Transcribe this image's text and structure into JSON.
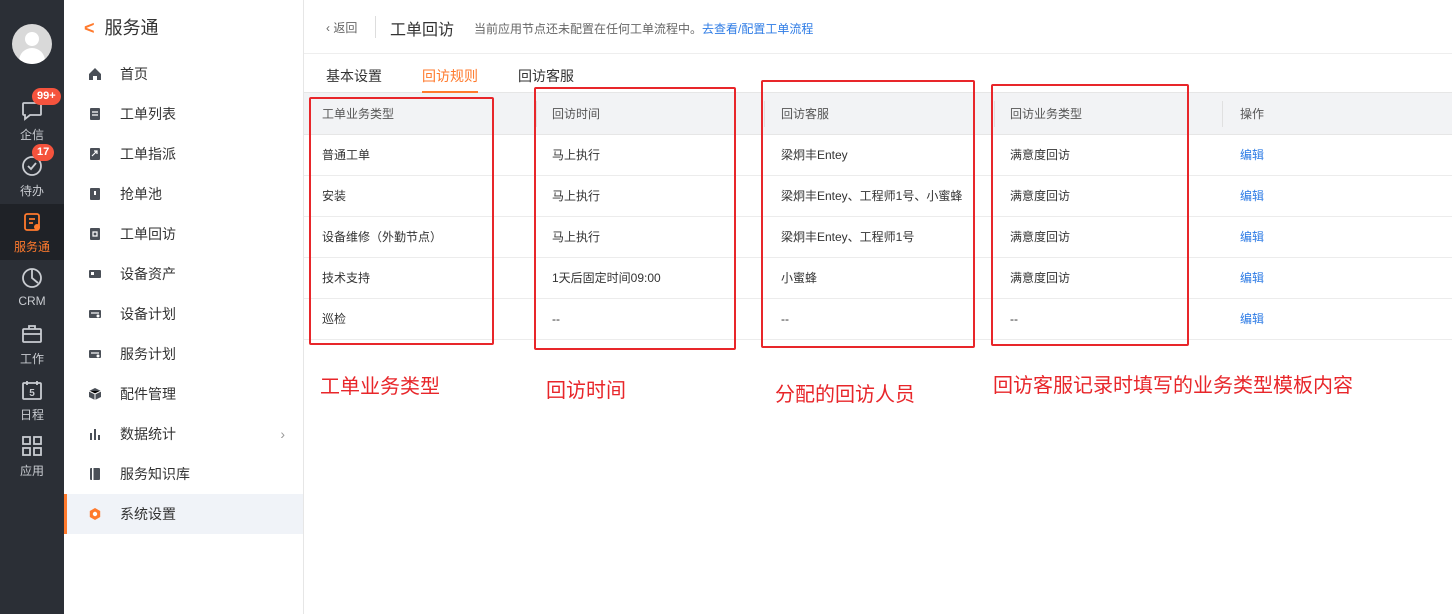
{
  "rail": {
    "items": [
      {
        "label": "企信",
        "badge": "99+",
        "icon": "chat-bubble-icon"
      },
      {
        "label": "待办",
        "badge": "17",
        "icon": "check-circle-icon"
      },
      {
        "label": "服务通",
        "icon": "service-icon",
        "active": true
      },
      {
        "label": "CRM",
        "icon": "pie-chart-icon"
      },
      {
        "label": "工作",
        "icon": "briefcase-icon"
      },
      {
        "label": "日程",
        "icon": "calendar-icon",
        "day": "5"
      },
      {
        "label": "应用",
        "icon": "grid-icon"
      }
    ]
  },
  "sidebar": {
    "title": "服务通",
    "items": [
      {
        "label": "首页",
        "icon": "home-icon"
      },
      {
        "label": "工单列表",
        "icon": "clipboard-icon"
      },
      {
        "label": "工单指派",
        "icon": "assign-icon"
      },
      {
        "label": "抢单池",
        "icon": "pool-icon"
      },
      {
        "label": "工单回访",
        "icon": "revisit-icon"
      },
      {
        "label": "设备资产",
        "icon": "device-card-icon"
      },
      {
        "label": "设备计划",
        "icon": "device-plan-icon"
      },
      {
        "label": "服务计划",
        "icon": "service-plan-icon"
      },
      {
        "label": "配件管理",
        "icon": "box-icon"
      },
      {
        "label": "数据统计",
        "icon": "bar-chart-icon",
        "arrow": "›"
      },
      {
        "label": "服务知识库",
        "icon": "book-icon"
      },
      {
        "label": "系统设置",
        "icon": "settings-icon",
        "active": true
      }
    ]
  },
  "topbar": {
    "back_label": "‹ 返回",
    "title": "工单回访",
    "hint": "当前应用节点还未配置在任何工单流程中。",
    "hint_link": "去查看/配置工单流程"
  },
  "tabs": [
    {
      "label": "基本设置"
    },
    {
      "label": "回访规则",
      "active": true
    },
    {
      "label": "回访客服"
    }
  ],
  "table": {
    "headers": [
      "工单业务类型",
      "回访时间",
      "回访客服",
      "回访业务类型",
      "操作"
    ],
    "rows": [
      [
        "普通工单",
        "马上执行",
        "梁炯丰Entey",
        "满意度回访",
        "编辑"
      ],
      [
        "安装",
        "马上执行",
        "梁炯丰Entey、工程师1号、小蜜蜂",
        "满意度回访",
        "编辑"
      ],
      [
        "设备维修（外勤节点）",
        "马上执行",
        "梁炯丰Entey、工程师1号",
        "满意度回访",
        "编辑"
      ],
      [
        "技术支持",
        "1天后固定时间09:00",
        "小蜜蜂",
        "满意度回访",
        "编辑"
      ],
      [
        "巡检",
        "--",
        "--",
        "--",
        "编辑"
      ]
    ]
  },
  "annotations": [
    "工单业务类型",
    "回访时间",
    "分配的回访人员",
    "回访客服记录时填写的业务类型模板内容"
  ],
  "colors": {
    "accent": "#ff7a2d",
    "link": "#2d7be5",
    "annotation": "#e8262a",
    "rail_bg": "#2b2f36",
    "badge": "#f5533d"
  }
}
